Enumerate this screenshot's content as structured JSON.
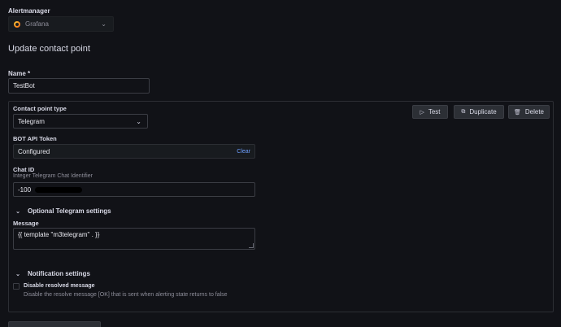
{
  "alertmanager": {
    "label": "Alertmanager",
    "selected": "Grafana",
    "icon": "grafana-logo-icon"
  },
  "page": {
    "title": "Update contact point"
  },
  "name": {
    "label": "Name *",
    "value": "TestBot"
  },
  "contact_point": {
    "type_label": "Contact point type",
    "type_value": "Telegram",
    "buttons": {
      "test": "Test",
      "duplicate": "Duplicate",
      "delete": "Delete"
    },
    "bot_token": {
      "label": "BOT API Token",
      "value": "Configured",
      "clear": "Clear"
    },
    "chat_id": {
      "label": "Chat ID",
      "description": "Integer Telegram Chat Identifier",
      "value": "-100"
    },
    "optional_section": {
      "label": "Optional Telegram settings",
      "message_label": "Message",
      "message_value": "{{ template \"m3telegram\" . }}"
    },
    "notification_section": {
      "label": "Notification settings",
      "disable_resolved_label": "Disable resolved message",
      "disable_resolved_desc": "Disable the resolve message [OK] that is sent when alerting state returns to false",
      "disable_resolved_checked": false
    }
  },
  "colors": {
    "background": "#111217",
    "panel_border": "#2c2e34",
    "text": "#ccccdc",
    "link": "#6e9fff"
  }
}
